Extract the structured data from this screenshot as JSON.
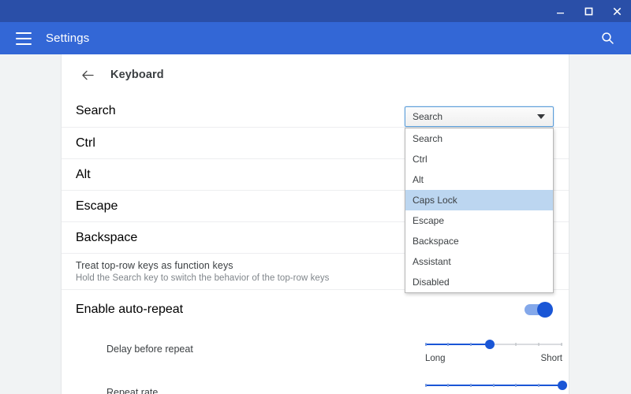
{
  "window": {
    "controls": [
      {
        "name": "minimize",
        "glyph": "minimize-icon"
      },
      {
        "name": "maximize",
        "glyph": "maximize-icon"
      },
      {
        "name": "close",
        "glyph": "close-icon"
      }
    ]
  },
  "header": {
    "menu_icon": "hamburger-menu-icon",
    "title": "Settings",
    "search_icon": "search-icon"
  },
  "page": {
    "back_icon": "back-arrow-icon",
    "title": "Keyboard"
  },
  "rows": [
    {
      "label": "Search"
    },
    {
      "label": "Ctrl"
    },
    {
      "label": "Alt"
    },
    {
      "label": "Escape"
    },
    {
      "label": "Backspace"
    },
    {
      "label": "Treat top-row keys as function keys",
      "sub": "Hold the Search key to switch the behavior of the top-row keys"
    },
    {
      "label": "Enable auto-repeat"
    }
  ],
  "select": {
    "value": "Search",
    "arrow_icon": "chevron-down-icon",
    "expanded": true,
    "options": [
      {
        "label": "Search",
        "selected": false
      },
      {
        "label": "Ctrl",
        "selected": false
      },
      {
        "label": "Alt",
        "selected": false
      },
      {
        "label": "Caps Lock",
        "selected": true
      },
      {
        "label": "Escape",
        "selected": false
      },
      {
        "label": "Backspace",
        "selected": false
      },
      {
        "label": "Assistant",
        "selected": false
      },
      {
        "label": "Disabled",
        "selected": false
      }
    ]
  },
  "auto_repeat": {
    "toggle_on": true
  },
  "delay_slider": {
    "label": "Delay before repeat",
    "min_label": "Long",
    "max_label": "Short",
    "percent": 47
  },
  "repeat_slider": {
    "label": "Repeat rate",
    "percent": 100
  },
  "colors": {
    "titlebar": "#2a4fa8",
    "header": "#3367d6",
    "accent": "#1a56d6",
    "option_highlight": "#bcd6f0",
    "page_bg": "#f1f3f4"
  }
}
